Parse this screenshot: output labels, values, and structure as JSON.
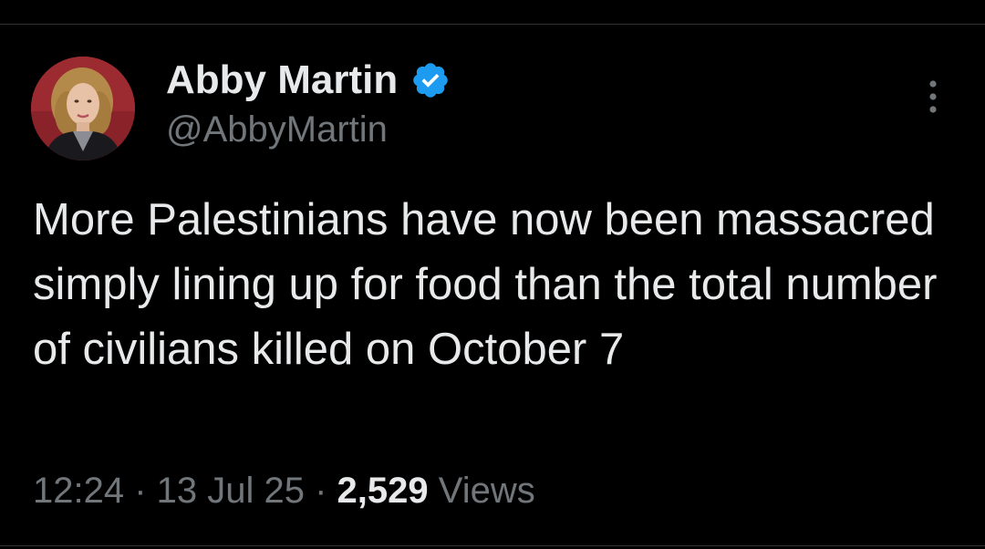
{
  "author": {
    "name": "Abby Martin",
    "handle": "@AbbyMartin",
    "verified": true,
    "verified_color": "#1d9bf0"
  },
  "tweet": {
    "text": "More Palestinians have now been massacred simply lining up for food than the total number of civilians killed on October 7"
  },
  "meta": {
    "time": "12:24",
    "separator_1": " · ",
    "date": "13 Jul 25",
    "separator_2": " · ",
    "views_count": "2,529",
    "views_label": " Views"
  },
  "icons": {
    "verified": "verified-badge-icon",
    "more": "more-vertical-icon"
  },
  "colors": {
    "background": "#000000",
    "primary_text": "#e7e9ea",
    "secondary_text": "#71767b",
    "divider": "#2f3336"
  }
}
